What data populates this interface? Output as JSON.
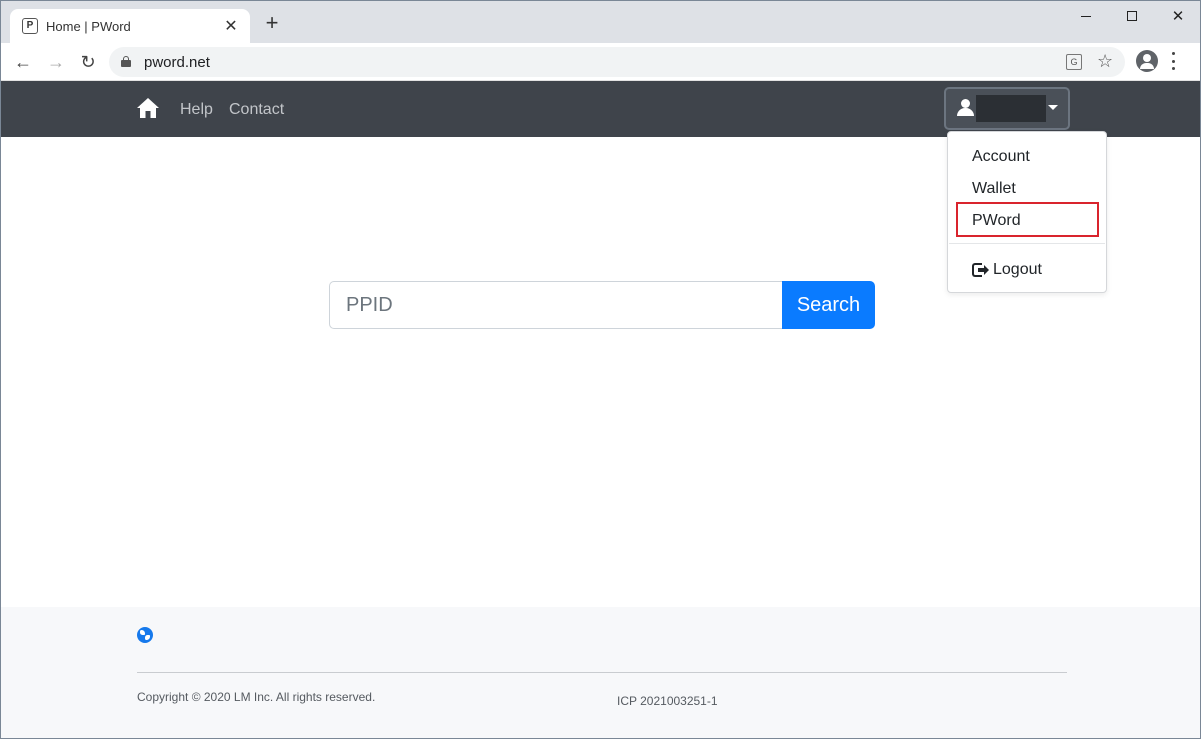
{
  "browser": {
    "tab_title": "Home | PWord",
    "tab_favicon": "P",
    "close_glyph": "✕",
    "new_tab_glyph": "+",
    "url": "pword.net",
    "back_glyph": "←",
    "forward_glyph": "→",
    "reload_glyph": "↻",
    "star_glyph": "☆",
    "translate_glyph": "G",
    "icons": [
      "back-arrow-icon",
      "forward-arrow-icon",
      "reload-icon",
      "lock-icon",
      "translate-icon",
      "star-icon",
      "profile-icon",
      "menu-icon"
    ]
  },
  "navbar": {
    "help": "Help",
    "contact": "Contact",
    "icons": [
      "home-icon",
      "user-icon",
      "caret-down-icon"
    ]
  },
  "user_menu": {
    "account": "Account",
    "wallet": "Wallet",
    "pword": "PWord",
    "logout": "Logout",
    "highlight_color": "#d9242d"
  },
  "search": {
    "placeholder": "PPID",
    "button_label": "Search",
    "button_color": "#0a7bff"
  },
  "footer": {
    "copyright": "Copyright © 2020 LM Inc. All rights reserved.",
    "icp": "ICP 2021003251-1",
    "icons": [
      "globe-icon"
    ]
  }
}
